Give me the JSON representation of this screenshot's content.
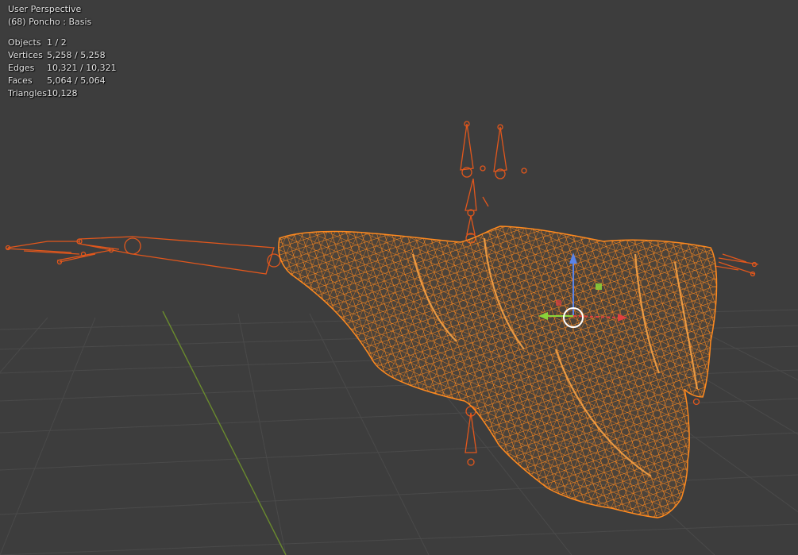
{
  "viewport": {
    "perspective_label": "User Perspective",
    "object_label": "(68) Poncho : Basis"
  },
  "stats": [
    {
      "label": "Objects",
      "value": "1 / 2"
    },
    {
      "label": "Vertices",
      "value": "5,258 / 5,258"
    },
    {
      "label": "Edges",
      "value": "10,321 / 10,321"
    },
    {
      "label": "Faces",
      "value": "5,064 / 5,064"
    },
    {
      "label": "Triangles",
      "value": "10,128"
    }
  ],
  "colors": {
    "background": "#3d3d3d",
    "grid": "#4a4a4a",
    "y_axis": "#6a8a2e",
    "selection": "#ff8a1f",
    "armature": "#e2571c",
    "gizmo_x": "#e0403f",
    "gizmo_y": "#8ad43a",
    "gizmo_z": "#5a84e8"
  },
  "icons": {
    "transform_pivot": "circle-icon",
    "x_axis_arrow": "arrow-right-icon",
    "y_axis_arrow": "arrow-left-icon",
    "z_axis_arrow": "arrow-up-icon"
  }
}
